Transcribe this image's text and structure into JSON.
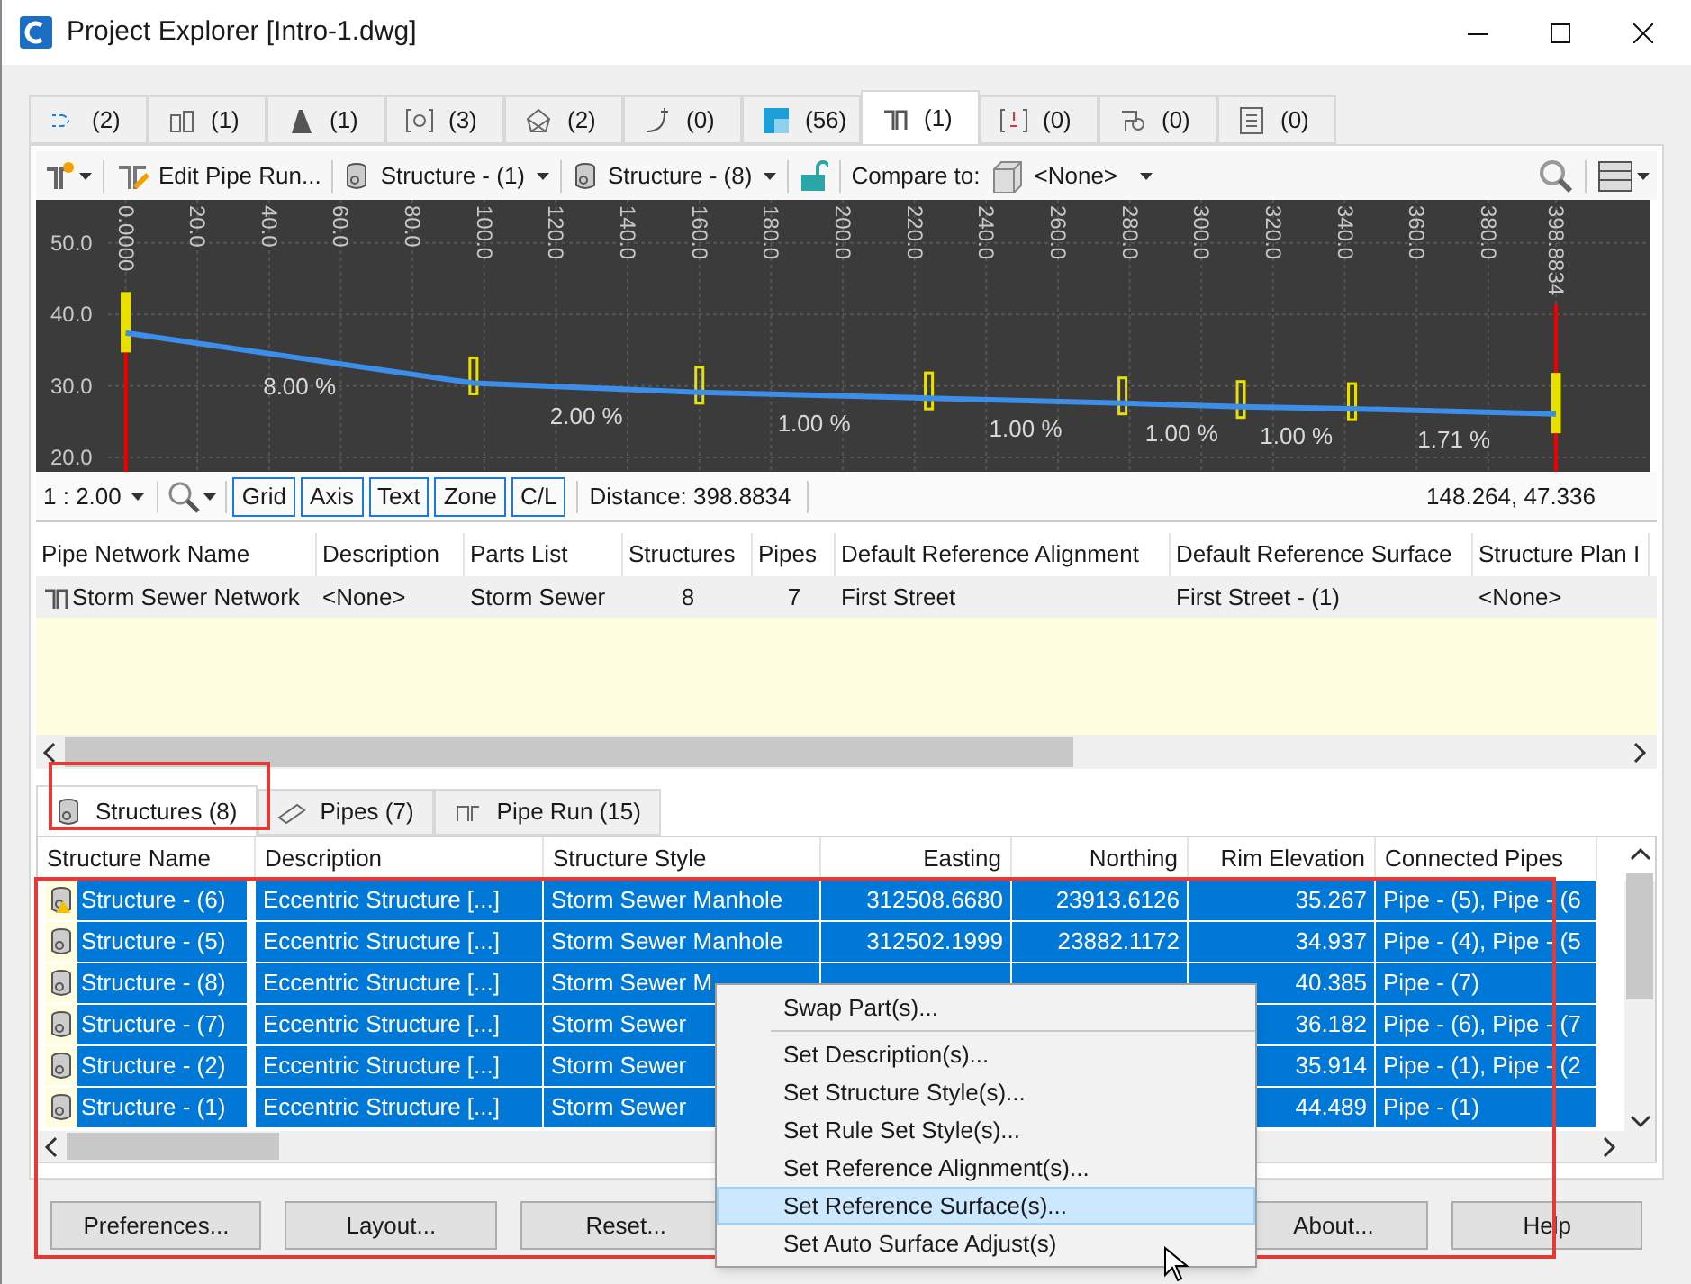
{
  "window": {
    "title": "Project Explorer [Intro-1.dwg]"
  },
  "tabs": [
    {
      "label": "(2)",
      "selected": false
    },
    {
      "label": "(1)",
      "selected": false
    },
    {
      "label": "(1)",
      "selected": false
    },
    {
      "label": "(3)",
      "selected": false
    },
    {
      "label": "(2)",
      "selected": false
    },
    {
      "label": "(0)",
      "selected": false
    },
    {
      "label": "(56)",
      "selected": false
    },
    {
      "label": "(1)",
      "selected": true
    },
    {
      "label": "(0)",
      "selected": false
    },
    {
      "label": "(0)",
      "selected": false
    },
    {
      "label": "(0)",
      "selected": false
    }
  ],
  "toolbar": {
    "edit_button": "Edit Pipe Run...",
    "start_structure": "Structure - (1)",
    "end_structure": "Structure - (8)",
    "compare_label": "Compare to:",
    "compare_value": "<None>"
  },
  "chart_data": {
    "type": "line",
    "x": [
      0,
      97,
      160,
      224,
      278,
      311,
      342,
      398.8834
    ],
    "series": [
      {
        "color": "#3d8ee8",
        "values": [
          37.4,
          30.4,
          29.1,
          28.3,
          27.6,
          27.1,
          26.8,
          26.1
        ]
      }
    ],
    "xlim": [
      -25,
      425
    ],
    "ylim": [
      18,
      56
    ],
    "xticks": [
      {
        "value": 0,
        "label": "0.0000"
      },
      {
        "value": 20,
        "label": "20.0"
      },
      {
        "value": 40,
        "label": "40.0"
      },
      {
        "value": 60,
        "label": "60.0"
      },
      {
        "value": 80,
        "label": "80.0"
      },
      {
        "value": 100,
        "label": "100.0"
      },
      {
        "value": 120,
        "label": "120.0"
      },
      {
        "value": 140,
        "label": "140.0"
      },
      {
        "value": 160,
        "label": "160.0"
      },
      {
        "value": 180,
        "label": "180.0"
      },
      {
        "value": 200,
        "label": "200.0"
      },
      {
        "value": 220,
        "label": "220.0"
      },
      {
        "value": 240,
        "label": "240.0"
      },
      {
        "value": 260,
        "label": "260.0"
      },
      {
        "value": 280,
        "label": "280.0"
      },
      {
        "value": 300,
        "label": "300.0"
      },
      {
        "value": 320,
        "label": "320.0"
      },
      {
        "value": 340,
        "label": "340.0"
      },
      {
        "value": 360,
        "label": "360.0"
      },
      {
        "value": 380,
        "label": "380.0"
      },
      {
        "value": 398.8834,
        "label": "398.8834"
      }
    ],
    "yticks": [
      {
        "value": 20,
        "label": "20.0"
      },
      {
        "value": 30,
        "label": "30.0"
      },
      {
        "value": 40,
        "label": "40.0"
      },
      {
        "value": 50,
        "label": "50.0"
      }
    ],
    "grid": true,
    "annotations": [
      "8.00 %",
      "2.00 %",
      "1.00 %",
      "1.00 %",
      "1.00 %",
      "1.00 %",
      "1.71 %"
    ]
  },
  "chart_toolbar": {
    "scale": "1 : 2.00",
    "toggles": [
      "Grid",
      "Axis",
      "Text",
      "Zone",
      "C/L"
    ],
    "distance": "Distance: 398.8834",
    "coordinates": "148.264, 47.336"
  },
  "network_table": {
    "columns": [
      "Pipe Network Name",
      "Description",
      "Parts List",
      "Structures",
      "Pipes",
      "Default Reference Alignment",
      "Default Reference Surface",
      "Structure Plan I"
    ],
    "rows": [
      [
        "Storm Sewer Network",
        "<None>",
        "Storm Sewer",
        "8",
        "7",
        "First Street",
        "First Street - (1)",
        "<None>"
      ]
    ]
  },
  "sub_tabs": [
    {
      "label": "Structures (8)",
      "selected": true
    },
    {
      "label": "Pipes (7)",
      "selected": false
    },
    {
      "label": "Pipe Run (15)",
      "selected": false
    }
  ],
  "structures_table": {
    "columns": [
      "Structure Name",
      "Description",
      "Structure Style",
      "Easting",
      "Northing",
      "Rim Elevation",
      "Connected Pipes"
    ],
    "rows": [
      {
        "cells": [
          "Structure - (6)",
          "Eccentric Structure  [...]",
          "Storm Sewer Manhole",
          "312508.6680",
          "23913.6126",
          "35.267",
          "Pipe - (5), Pipe - (6"
        ],
        "selected": true,
        "warning": true
      },
      {
        "cells": [
          "Structure - (5)",
          "Eccentric Structure  [...]",
          "Storm Sewer Manhole",
          "312502.1999",
          "23882.1172",
          "34.937",
          "Pipe - (4), Pipe - (5"
        ],
        "selected": true,
        "warning": false
      },
      {
        "cells": [
          "Structure - (8)",
          "Eccentric Structure  [...]",
          "Storm Sewer M",
          "",
          "",
          "40.385",
          "Pipe - (7)"
        ],
        "selected": true,
        "warning": false
      },
      {
        "cells": [
          "Structure - (7)",
          "Eccentric Structure  [...]",
          "Storm Sewer",
          "",
          "",
          "36.182",
          "Pipe - (6), Pipe - (7"
        ],
        "selected": true,
        "warning": false
      },
      {
        "cells": [
          "Structure - (2)",
          "Eccentric Structure  [...]",
          "Storm Sewer",
          "",
          "",
          "35.914",
          "Pipe - (1), Pipe - (2"
        ],
        "selected": true,
        "warning": false
      },
      {
        "cells": [
          "Structure - (1)",
          "Eccentric Structure  [...]",
          "Storm Sewer",
          "",
          "",
          "44.489",
          "Pipe - (1)"
        ],
        "selected": true,
        "warning": false
      }
    ]
  },
  "buttons": [
    "Preferences...",
    "Layout...",
    "Reset...",
    "About...",
    "Help"
  ],
  "context_menu": [
    {
      "label": "Swap Part(s)...",
      "selected": false,
      "divider_after": true
    },
    {
      "label": "Set Description(s)...",
      "selected": false,
      "divider_after": false
    },
    {
      "label": "Set Structure Style(s)...",
      "selected": false,
      "divider_after": false
    },
    {
      "label": "Set Rule Set Style(s)...",
      "selected": false,
      "divider_after": false
    },
    {
      "label": "Set Reference Alignment(s)...",
      "selected": false,
      "divider_after": false
    },
    {
      "label": "Set Reference Surface(s)...",
      "selected": true,
      "divider_after": false
    },
    {
      "label": "Set Auto Surface Adjust(s)",
      "selected": false,
      "divider_after": false
    }
  ]
}
